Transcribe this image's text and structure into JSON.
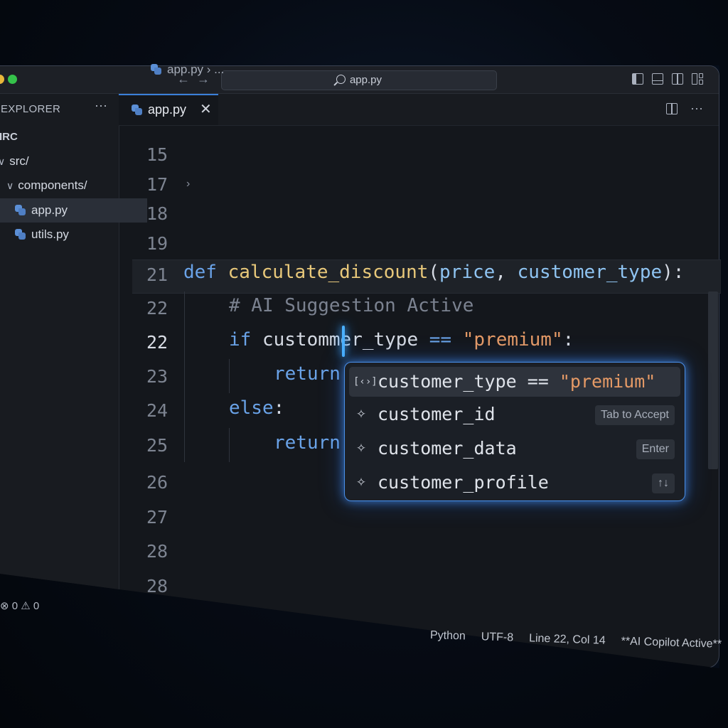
{
  "titlebar": {
    "search_text": "app.py",
    "back_icon": "arrow-left-icon",
    "forward_icon": "arrow-right-icon"
  },
  "sidebar": {
    "title": "EXPLORER",
    "more": "···",
    "root": "IRC",
    "items": [
      {
        "label": "src/",
        "type": "folder"
      },
      {
        "label": "components/",
        "type": "folder"
      },
      {
        "label": "app.py",
        "type": "file",
        "selected": true
      },
      {
        "label": "utils.py",
        "type": "file"
      }
    ]
  },
  "tabs": [
    {
      "label": "app.py",
      "close": "✕"
    }
  ],
  "breadcrumb": "app.py  › ...",
  "editor": {
    "line_numbers": [
      "15",
      "17",
      "18",
      "19",
      "21",
      "22",
      "22",
      "23",
      "24",
      "25",
      "26",
      "27",
      "28",
      "28"
    ],
    "code": {
      "def_kw": "def",
      "fn_name": "calculate_discount",
      "param1": "price",
      "sep": ", ",
      "param2": "customer_type",
      "close": "):",
      "comment": "# AI Suggestion Active",
      "if_kw": "if",
      "if_expr": " custommer_type ",
      "eq": "==",
      "str": " \"premium\"",
      "colon": ":",
      "return1": "return",
      "else_kw": "else",
      "else_colon": ":",
      "return2": "return"
    }
  },
  "autocomplete": {
    "items": [
      {
        "icon": "[‹›]",
        "text": "customer_type == \"premium\"",
        "hint": ""
      },
      {
        "icon": "✧",
        "text": "customer_id",
        "hint": "Tab to Accept"
      },
      {
        "icon": "✧",
        "text": "customer_data",
        "hint": "Enter"
      },
      {
        "icon": "✧",
        "text": "customer_profile",
        "hint": "↑↓"
      }
    ]
  },
  "status": {
    "problems": "⊗ 0 ⚠ 0",
    "language": "Python",
    "encoding": "UTF-8",
    "position": "Line 22, Col 14",
    "copilot": "**AI Copilot Active**"
  },
  "colors": {
    "accent": "#4a8fe8",
    "keyword": "#6aa3e8",
    "function": "#e8c87a",
    "string": "#e59a66"
  }
}
